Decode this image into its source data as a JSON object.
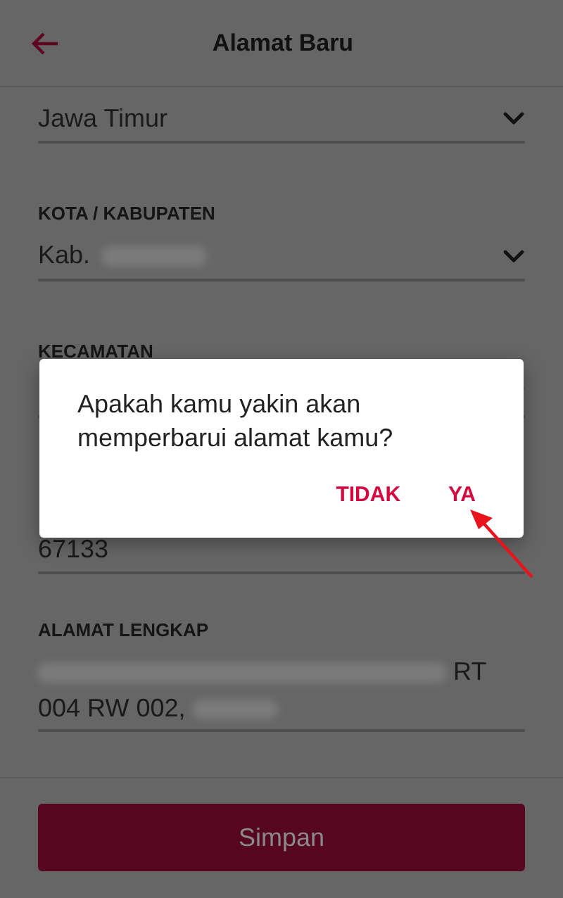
{
  "header": {
    "title": "Alamat Baru"
  },
  "fields": [
    {
      "kind": "select",
      "value": "Jawa Timur"
    },
    {
      "kind": "select",
      "label": "KOTA / KABUPATEN",
      "value": "Kab.",
      "redacted": true
    },
    {
      "kind": "select",
      "label": "KECAMATAN"
    },
    {
      "kind": "text",
      "value": "67133"
    },
    {
      "kind": "address",
      "label": "ALAMAT LENGKAP",
      "parts": [
        {
          "kind": "redacted"
        },
        {
          "kind": "text",
          "text": "RT 004 RW 002,"
        },
        {
          "kind": "redacted"
        }
      ]
    }
  ],
  "save_button": {
    "label": "Simpan"
  },
  "dialog": {
    "message": "Apakah kamu yakin akan memperbarui alamat kamu?",
    "buttons": [
      "TIDAK",
      "YA"
    ]
  },
  "annotation": {
    "kind": "arrow"
  }
}
